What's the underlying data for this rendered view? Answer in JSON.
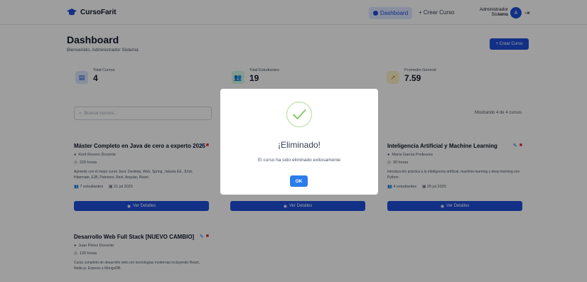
{
  "navbar": {
    "brand": "CursoFarit",
    "dashboard_label": "Dashboard",
    "create_label": "+ Crear Curso",
    "user_name": "Administrador Sistema",
    "user_role": "admin",
    "avatar_letter": "A"
  },
  "header": {
    "title": "Dashboard",
    "subtitle": "Bienvenido, Administrador Sistema",
    "create_button": "+ Crear Curso"
  },
  "stats": [
    {
      "label": "Total Cursos",
      "value": "4",
      "icon": "book-icon",
      "color": "#dbe6ff"
    },
    {
      "label": "Total Estudiantes",
      "value": "19",
      "icon": "users-icon",
      "color": "#d1fae5"
    },
    {
      "label": "Promedio General",
      "value": "7.59",
      "icon": "chart-icon",
      "color": "#fef3c7"
    }
  ],
  "search": {
    "placeholder": "Buscar cursos..."
  },
  "showing_text": "Mostrando 4 de 4 cursos",
  "courses": [
    {
      "title": "Máster Completo en Java de cero a experto 2025",
      "teacher": "Kerit Rosero Docente",
      "hours": "220 horas",
      "description": "Aprende con el mejor curso Java: Desktop, Web, Spring, Jakarta EE, JUnit, Hibernate, EJB, Patrones, Rest, Angular, React.",
      "students": "7 estudiantes",
      "date": "21 jul 2025",
      "details_label": "Ver Detalles"
    },
    {
      "title": "",
      "teacher": "",
      "hours": "",
      "description": "",
      "students": "",
      "date": "",
      "details_label": "Ver Detalles"
    },
    {
      "title": "Inteligencia Artificial y Machine Learning",
      "teacher": "María García Profesora",
      "hours": "30 horas",
      "description": "Introducción práctica a la inteligencia artificial, machine learning y deep learning con Python.",
      "students": "4 estudiantes",
      "date": "20 jul 2025",
      "details_label": "Ver Detalles"
    },
    {
      "title": "Desarrollo Web Full Stack [NUEVO CAMBIO]",
      "teacher": "Juan Pérez Docente",
      "hours": "120 horas",
      "description": "Curso completo de desarrollo web con tecnologías modernas incluyendo React, Node.js, Express y MongoDB."
    }
  ],
  "modal": {
    "title": "¡Eliminado!",
    "message": "El curso ha sido eliminado exitosamente",
    "ok_label": "OK"
  },
  "colors": {
    "accent": "#1d4ed8",
    "success": "#86c765",
    "danger": "#dc2626",
    "ok_button": "#2b7de9"
  }
}
